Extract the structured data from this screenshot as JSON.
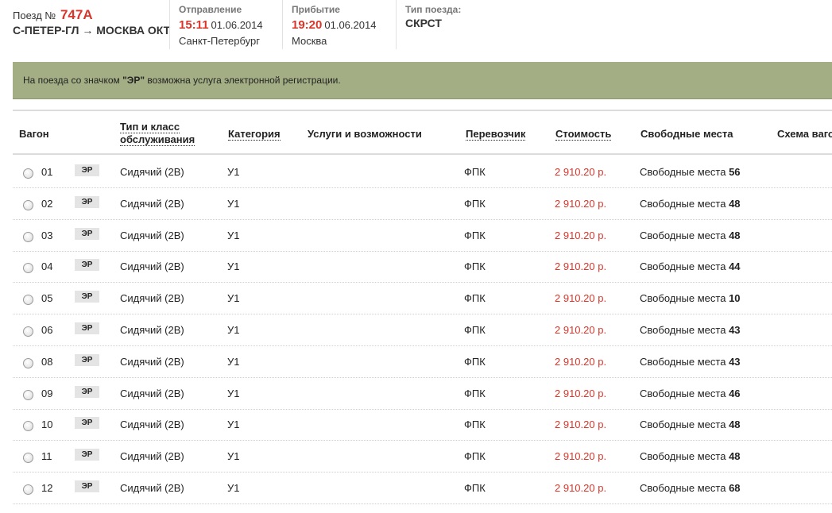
{
  "train": {
    "label": "Поезд №",
    "number": "747А",
    "route": "С-ПЕТЕР-ГЛ → МОСКВА ОКТ"
  },
  "departure": {
    "title": "Отправление",
    "time": "15:11",
    "date": "01.06.2014",
    "city": "Санкт-Петербург"
  },
  "arrival": {
    "title": "Прибытие",
    "time": "19:20",
    "date": "01.06.2014",
    "city": "Москва"
  },
  "train_type": {
    "title": "Тип поезда:",
    "value": "СКРСТ"
  },
  "banner": {
    "prefix": "На поезда со значком ",
    "badge": "\"ЭР\"",
    "suffix": " возможна услуга электронной регистрации."
  },
  "table": {
    "headers": {
      "wagon": "Вагон",
      "type_line1": "Тип и класс",
      "type_line2": "обслуживания",
      "category": "Категория",
      "services": "Услуги и возможности",
      "carrier": "Перевозчик",
      "price": "Стоимость",
      "free": "Свободные места",
      "scheme": "Схема ваго"
    },
    "badge_label": "ЭР",
    "seats_label": "Свободные места",
    "rows": [
      {
        "wagon": "01",
        "type": "Сидячий (2В)",
        "category": "У1",
        "carrier": "ФПК",
        "price": "2 910.20 р.",
        "seats": "56"
      },
      {
        "wagon": "02",
        "type": "Сидячий (2В)",
        "category": "У1",
        "carrier": "ФПК",
        "price": "2 910.20 р.",
        "seats": "48"
      },
      {
        "wagon": "03",
        "type": "Сидячий (2В)",
        "category": "У1",
        "carrier": "ФПК",
        "price": "2 910.20 р.",
        "seats": "48"
      },
      {
        "wagon": "04",
        "type": "Сидячий (2В)",
        "category": "У1",
        "carrier": "ФПК",
        "price": "2 910.20 р.",
        "seats": "44"
      },
      {
        "wagon": "05",
        "type": "Сидячий (2В)",
        "category": "У1",
        "carrier": "ФПК",
        "price": "2 910.20 р.",
        "seats": "10"
      },
      {
        "wagon": "06",
        "type": "Сидячий (2В)",
        "category": "У1",
        "carrier": "ФПК",
        "price": "2 910.20 р.",
        "seats": "43"
      },
      {
        "wagon": "08",
        "type": "Сидячий (2В)",
        "category": "У1",
        "carrier": "ФПК",
        "price": "2 910.20 р.",
        "seats": "43"
      },
      {
        "wagon": "09",
        "type": "Сидячий (2В)",
        "category": "У1",
        "carrier": "ФПК",
        "price": "2 910.20 р.",
        "seats": "46"
      },
      {
        "wagon": "10",
        "type": "Сидячий (2В)",
        "category": "У1",
        "carrier": "ФПК",
        "price": "2 910.20 р.",
        "seats": "48"
      },
      {
        "wagon": "11",
        "type": "Сидячий (2В)",
        "category": "У1",
        "carrier": "ФПК",
        "price": "2 910.20 р.",
        "seats": "48"
      },
      {
        "wagon": "12",
        "type": "Сидячий (2В)",
        "category": "У1",
        "carrier": "ФПК",
        "price": "2 910.20 р.",
        "seats": "68"
      }
    ]
  },
  "colors": {
    "accent_red": "#d9352a",
    "banner_bg": "#a3ae84"
  }
}
